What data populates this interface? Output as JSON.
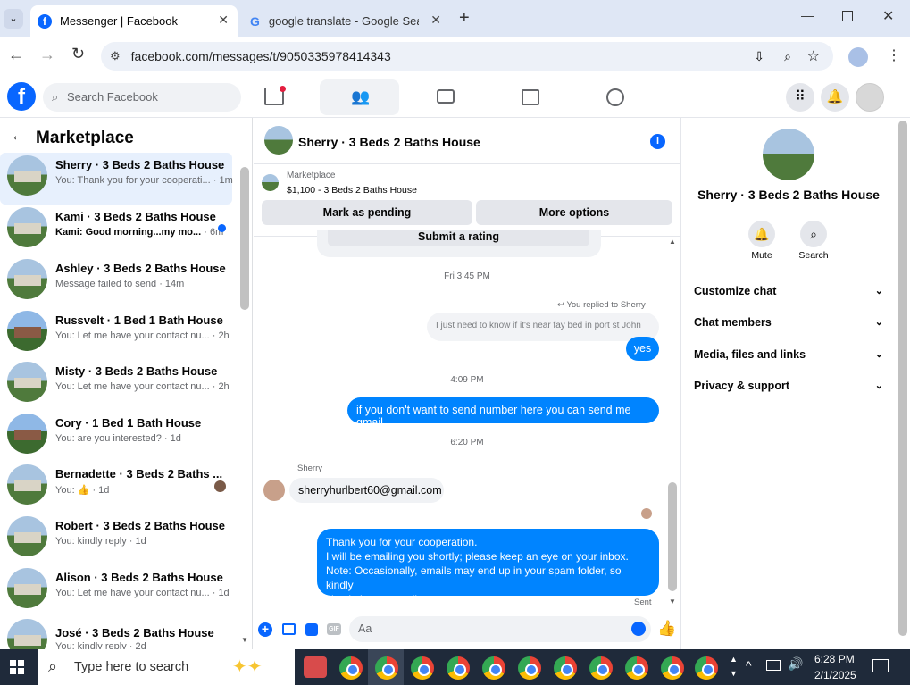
{
  "browser": {
    "tabs": [
      {
        "title": "Messenger | Facebook",
        "active": true
      },
      {
        "title": "google translate - Google Searc",
        "active": false
      }
    ],
    "url": "facebook.com/messages/t/9050335978414343"
  },
  "fb_header": {
    "search_placeholder": "Search Facebook",
    "accent": "#0866ff"
  },
  "left": {
    "title": "Marketplace",
    "conversations": [
      {
        "name": "Sherry · 3 Beds 2 Baths House",
        "preview": "You: Thank you for your cooperati...",
        "time": "· 1m",
        "selected": true
      },
      {
        "name": "Kami · 3 Beds 2 Baths House",
        "preview": "Kami: Good morning...my mo...",
        "time": "· 6m",
        "unread": true
      },
      {
        "name": "Ashley · 3 Beds 2 Baths House",
        "preview": "Message failed to send",
        "time": "· 14m"
      },
      {
        "name": "Russvelt · 1 Bed 1 Bath House",
        "preview": "You: Let me have your contact nu...",
        "time": "· 2h"
      },
      {
        "name": "Misty · 3 Beds 2 Baths House",
        "preview": "You: Let me have your contact nu...",
        "time": "· 2h"
      },
      {
        "name": "Cory · 1 Bed 1 Bath House",
        "preview": "You: are you interested?",
        "time": "· 1d"
      },
      {
        "name": "Bernadette · 3 Beds 2 Baths ...",
        "preview": "You: 👍",
        "time": "· 1d"
      },
      {
        "name": "Robert · 3 Beds 2 Baths House",
        "preview": "You: kindly reply",
        "time": "· 1d"
      },
      {
        "name": "Alison · 3 Beds 2 Baths House",
        "preview": "You: Let me have your contact nu...",
        "time": "· 1d"
      },
      {
        "name": "José · 3 Beds 2 Baths House",
        "preview": "You: kindly reply",
        "time": "· 2d"
      }
    ]
  },
  "chat": {
    "title": "Sherry · 3 Beds 2 Baths House",
    "listing_label": "Marketplace",
    "listing_price": "$1,100 - 3 Beds 2 Baths House",
    "mark_pending": "Mark as pending",
    "more_options": "More options",
    "submit_rating": "Submit a rating",
    "stamp1": "Fri 3:45 PM",
    "replied_to": "You replied to Sherry",
    "quoted": "I just need to know if it's near fay bed in port st John",
    "msg_yes": "yes",
    "stamp2": "4:09 PM",
    "msg_gmail": "if you don't want to send number here you can send me gmail",
    "stamp3": "6:20 PM",
    "sender": "Sherry",
    "msg_email": "sherryhurlbert60@gmail.com",
    "msg_final": [
      "Thank you for your cooperation.",
      "I will be emailing you shortly; please keep an eye on your inbox.",
      "Note: Occasionally, emails may end up in your spam folder, so kindly",
      "check there as well."
    ],
    "sent": "Sent",
    "composer_placeholder": "Aa"
  },
  "right": {
    "title": "Sherry · 3 Beds 2 Baths House",
    "mute": "Mute",
    "search": "Search",
    "sections": [
      "Customize chat",
      "Chat members",
      "Media, files and links",
      "Privacy & support"
    ]
  },
  "taskbar": {
    "search_placeholder": "Type here to search",
    "time": "6:28 PM",
    "date": "2/1/2025"
  }
}
